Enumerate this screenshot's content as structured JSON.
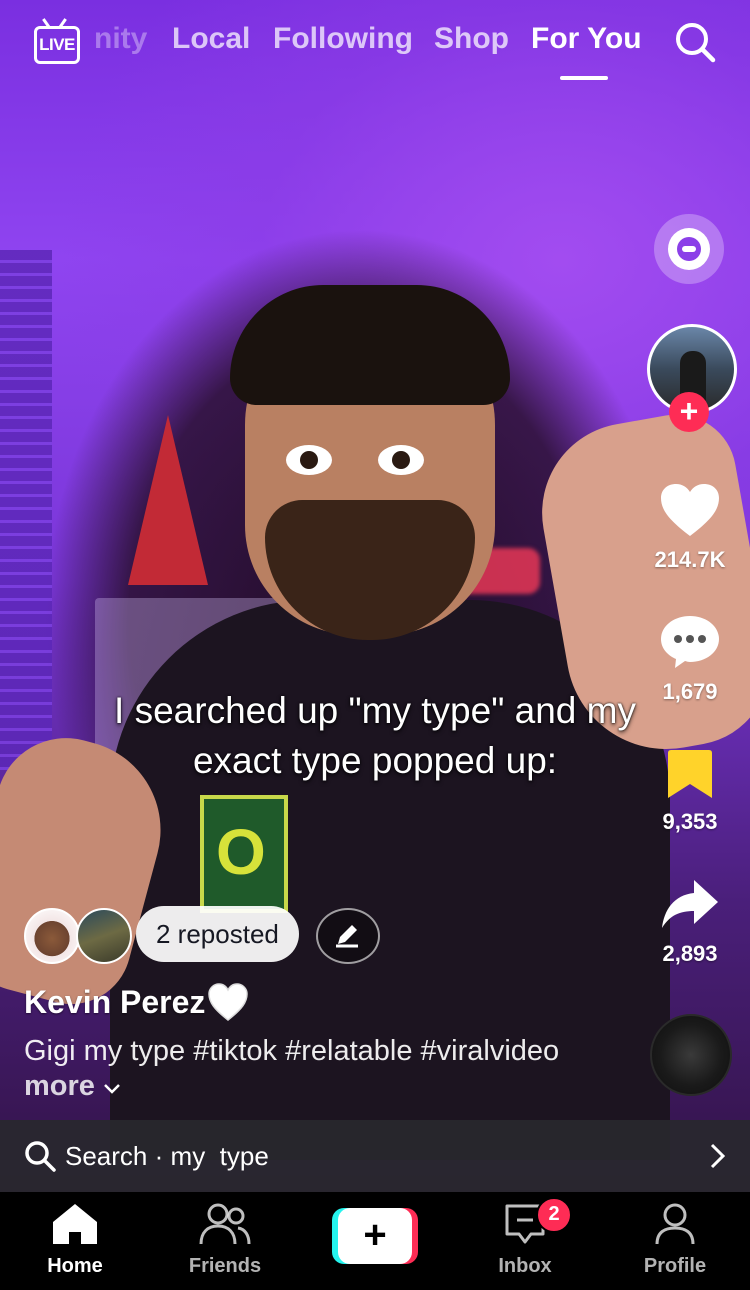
{
  "top_nav": {
    "live_label": "LIVE",
    "tabs": [
      "nity",
      "Local",
      "Following",
      "Shop",
      "For You"
    ],
    "active_tab": "For You"
  },
  "video": {
    "caption": "I searched up \"my type\" and my exact type popped up:"
  },
  "actions": {
    "likes": "214.7K",
    "comments": "1,679",
    "saves": "9,353",
    "shares": "2,893"
  },
  "repost": {
    "label": "2 reposted"
  },
  "post": {
    "author": "Kevin Perez",
    "description": "Gigi my type #tiktok #relatable #viralvideo",
    "more_label": "more"
  },
  "search_bar": {
    "prefix": "Search",
    "separator": "·",
    "query": "my  type"
  },
  "bottom_nav": {
    "items": [
      "Home",
      "Friends",
      "",
      "Inbox",
      "Profile"
    ],
    "create_symbol": "+",
    "inbox_badge": "2"
  },
  "colors": {
    "accent_red": "#fe2c55",
    "accent_cyan": "#25f4ee",
    "save_yellow": "#ffd32a"
  }
}
